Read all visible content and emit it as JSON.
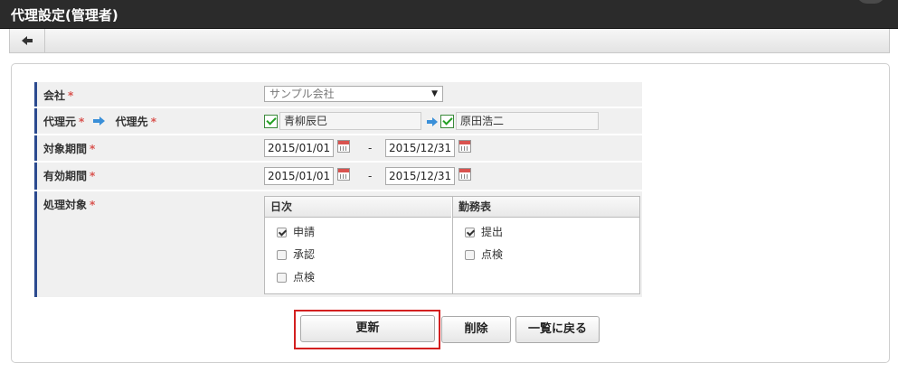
{
  "window": {
    "title": "代理設定(管理者)"
  },
  "toolbar": {
    "back_icon": "arrow-left-icon"
  },
  "form": {
    "company": {
      "label": "会社",
      "required_mark": "*",
      "value": "サンプル会社"
    },
    "proxy": {
      "from_label": "代理元",
      "to_label": "代理先",
      "required_mark": "*",
      "from_name": "青柳辰巳",
      "to_name": "原田浩二"
    },
    "target_period": {
      "label": "対象期間",
      "required_mark": "*",
      "start": "2015/01/01",
      "separator": "-",
      "end": "2015/12/31"
    },
    "valid_period": {
      "label": "有効期間",
      "required_mark": "*",
      "start": "2015/01/01",
      "separator": "-",
      "end": "2015/12/31"
    },
    "targets": {
      "label": "処理対象",
      "required_mark": "*",
      "columns": [
        {
          "header": "日次",
          "items": [
            {
              "label": "申請",
              "checked": true
            },
            {
              "label": "承認",
              "checked": false
            },
            {
              "label": "点検",
              "checked": false
            }
          ]
        },
        {
          "header": "勤務表",
          "items": [
            {
              "label": "提出",
              "checked": true
            },
            {
              "label": "点検",
              "checked": false
            }
          ]
        }
      ]
    }
  },
  "buttons": {
    "update": "更新",
    "delete": "削除",
    "back_to_list": "一覧に戻る"
  },
  "colors": {
    "title_bar": "#2b2b2b",
    "label_accent": "#2b4a8f",
    "required": "#d9534f",
    "highlight": "#d32020",
    "check_green": "#22a022"
  }
}
